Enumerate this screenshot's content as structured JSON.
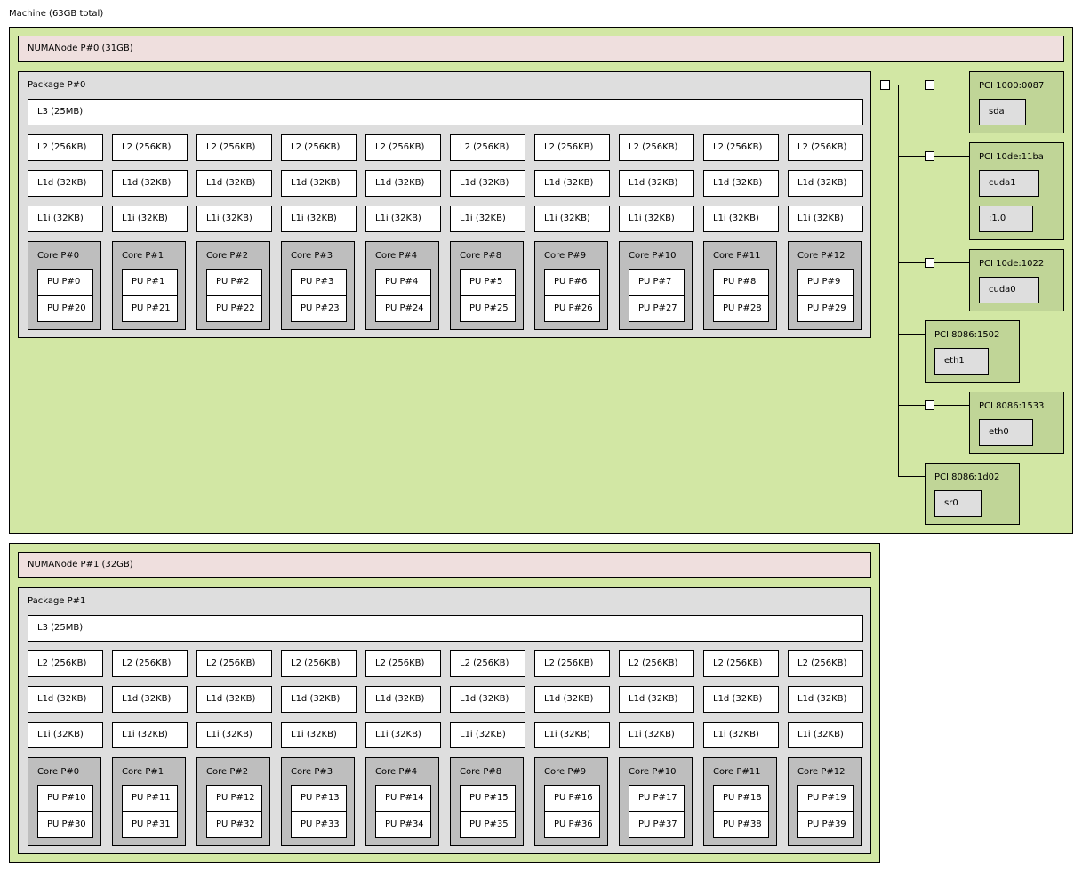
{
  "machine": {
    "label": "Machine (63GB total)"
  },
  "numa_nodes": [
    {
      "label": "NUMANode P#0 (31GB)",
      "package": {
        "label": "Package P#0",
        "l3": "L3 (25MB)",
        "l2": [
          "L2 (256KB)",
          "L2 (256KB)",
          "L2 (256KB)",
          "L2 (256KB)",
          "L2 (256KB)",
          "L2 (256KB)",
          "L2 (256KB)",
          "L2 (256KB)",
          "L2 (256KB)",
          "L2 (256KB)"
        ],
        "l1d": [
          "L1d (32KB)",
          "L1d (32KB)",
          "L1d (32KB)",
          "L1d (32KB)",
          "L1d (32KB)",
          "L1d (32KB)",
          "L1d (32KB)",
          "L1d (32KB)",
          "L1d (32KB)",
          "L1d (32KB)"
        ],
        "l1i": [
          "L1i (32KB)",
          "L1i (32KB)",
          "L1i (32KB)",
          "L1i (32KB)",
          "L1i (32KB)",
          "L1i (32KB)",
          "L1i (32KB)",
          "L1i (32KB)",
          "L1i (32KB)",
          "L1i (32KB)"
        ],
        "cores": [
          {
            "label": "Core P#0",
            "pus": [
              "PU P#0",
              "PU P#20"
            ]
          },
          {
            "label": "Core P#1",
            "pus": [
              "PU P#1",
              "PU P#21"
            ]
          },
          {
            "label": "Core P#2",
            "pus": [
              "PU P#2",
              "PU P#22"
            ]
          },
          {
            "label": "Core P#3",
            "pus": [
              "PU P#3",
              "PU P#23"
            ]
          },
          {
            "label": "Core P#4",
            "pus": [
              "PU P#4",
              "PU P#24"
            ]
          },
          {
            "label": "Core P#8",
            "pus": [
              "PU P#5",
              "PU P#25"
            ]
          },
          {
            "label": "Core P#9",
            "pus": [
              "PU P#6",
              "PU P#26"
            ]
          },
          {
            "label": "Core P#10",
            "pus": [
              "PU P#7",
              "PU P#27"
            ]
          },
          {
            "label": "Core P#11",
            "pus": [
              "PU P#8",
              "PU P#28"
            ]
          },
          {
            "label": "Core P#12",
            "pus": [
              "PU P#9",
              "PU P#29"
            ]
          }
        ]
      }
    },
    {
      "label": "NUMANode P#1 (32GB)",
      "package": {
        "label": "Package P#1",
        "l3": "L3 (25MB)",
        "l2": [
          "L2 (256KB)",
          "L2 (256KB)",
          "L2 (256KB)",
          "L2 (256KB)",
          "L2 (256KB)",
          "L2 (256KB)",
          "L2 (256KB)",
          "L2 (256KB)",
          "L2 (256KB)",
          "L2 (256KB)"
        ],
        "l1d": [
          "L1d (32KB)",
          "L1d (32KB)",
          "L1d (32KB)",
          "L1d (32KB)",
          "L1d (32KB)",
          "L1d (32KB)",
          "L1d (32KB)",
          "L1d (32KB)",
          "L1d (32KB)",
          "L1d (32KB)"
        ],
        "l1i": [
          "L1i (32KB)",
          "L1i (32KB)",
          "L1i (32KB)",
          "L1i (32KB)",
          "L1i (32KB)",
          "L1i (32KB)",
          "L1i (32KB)",
          "L1i (32KB)",
          "L1i (32KB)",
          "L1i (32KB)"
        ],
        "cores": [
          {
            "label": "Core P#0",
            "pus": [
              "PU P#10",
              "PU P#30"
            ]
          },
          {
            "label": "Core P#1",
            "pus": [
              "PU P#11",
              "PU P#31"
            ]
          },
          {
            "label": "Core P#2",
            "pus": [
              "PU P#12",
              "PU P#32"
            ]
          },
          {
            "label": "Core P#3",
            "pus": [
              "PU P#13",
              "PU P#33"
            ]
          },
          {
            "label": "Core P#4",
            "pus": [
              "PU P#14",
              "PU P#34"
            ]
          },
          {
            "label": "Core P#8",
            "pus": [
              "PU P#15",
              "PU P#35"
            ]
          },
          {
            "label": "Core P#9",
            "pus": [
              "PU P#16",
              "PU P#36"
            ]
          },
          {
            "label": "Core P#10",
            "pus": [
              "PU P#17",
              "PU P#37"
            ]
          },
          {
            "label": "Core P#11",
            "pus": [
              "PU P#18",
              "PU P#38"
            ]
          },
          {
            "label": "Core P#12",
            "pus": [
              "PU P#19",
              "PU P#39"
            ]
          }
        ]
      }
    }
  ],
  "pci_devices": [
    {
      "label": "PCI 1000:0087",
      "bridged": true,
      "os_devices": [
        "sda"
      ]
    },
    {
      "label": "PCI 10de:11ba",
      "bridged": true,
      "os_devices": [
        "cuda1",
        ":1.0"
      ]
    },
    {
      "label": "PCI 10de:1022",
      "bridged": true,
      "os_devices": [
        "cuda0"
      ]
    },
    {
      "label": "PCI 8086:1502",
      "bridged": false,
      "os_devices": [
        "eth1"
      ]
    },
    {
      "label": "PCI 8086:1533",
      "bridged": true,
      "os_devices": [
        "eth0"
      ]
    },
    {
      "label": "PCI 8086:1d02",
      "bridged": false,
      "os_devices": [
        "sr0"
      ]
    }
  ],
  "colors": {
    "numa_area": "#d2e7a4",
    "numa_bar": "#efdfde",
    "package": "#dedede",
    "cache": "#ffffff",
    "core": "#bebebe",
    "pu": "#ffffff",
    "pci_device": "#c0d597",
    "os_device": "#dedede"
  }
}
